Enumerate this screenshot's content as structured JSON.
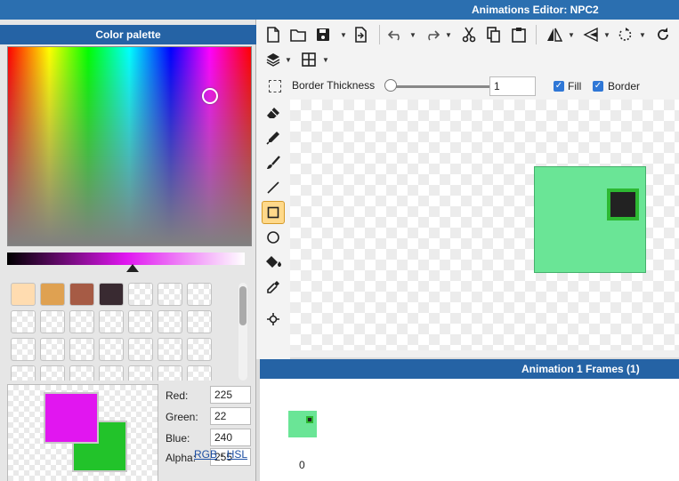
{
  "window": {
    "title": "Animations Editor: NPC2"
  },
  "palette": {
    "title": "Color palette",
    "swatch_colors": [
      "#ffdcb0",
      "#dfa151",
      "#a65b45",
      "#392a31"
    ],
    "primary_color": "#e116f0",
    "secondary_color": "#22c32a",
    "fields": [
      {
        "label": "Red:",
        "value": "225"
      },
      {
        "label": "Green:",
        "value": "22"
      },
      {
        "label": "Blue:",
        "value": "240"
      },
      {
        "label": "Alpha:",
        "value": "255"
      }
    ],
    "modes": {
      "rgb": "RGB",
      "sep": "-",
      "hsl": "HSL"
    }
  },
  "toolbar": {
    "icons": [
      "new-file-icon",
      "open-folder-icon",
      "save-icon",
      "export-icon",
      "undo-icon",
      "redo-icon",
      "cut-icon",
      "copy-icon",
      "paste-icon",
      "flip-horizontal-icon",
      "flip-vertical-icon",
      "rotate-icon",
      "refresh-icon",
      "layers-icon",
      "grid-icon"
    ]
  },
  "props": {
    "border_thickness_label": "Border Thickness",
    "border_thickness_value": "1",
    "fill_label": "Fill",
    "border_label": "Border",
    "fill_checked": true,
    "border_checked": true
  },
  "tools": [
    "eraser-icon",
    "pencil-icon",
    "brush-icon",
    "line-icon",
    "rectangle-icon",
    "ellipse-icon",
    "fill-bucket-icon",
    "eyedropper-icon",
    "move-point-icon"
  ],
  "active_tool": "rectangle-icon",
  "canvas": {
    "fill_color": "#6ae596",
    "border_color": "#2db932",
    "inner_color": "#222222"
  },
  "frames": {
    "title": "Animation 1 Frames (1)",
    "items": [
      {
        "index": "0"
      }
    ]
  }
}
